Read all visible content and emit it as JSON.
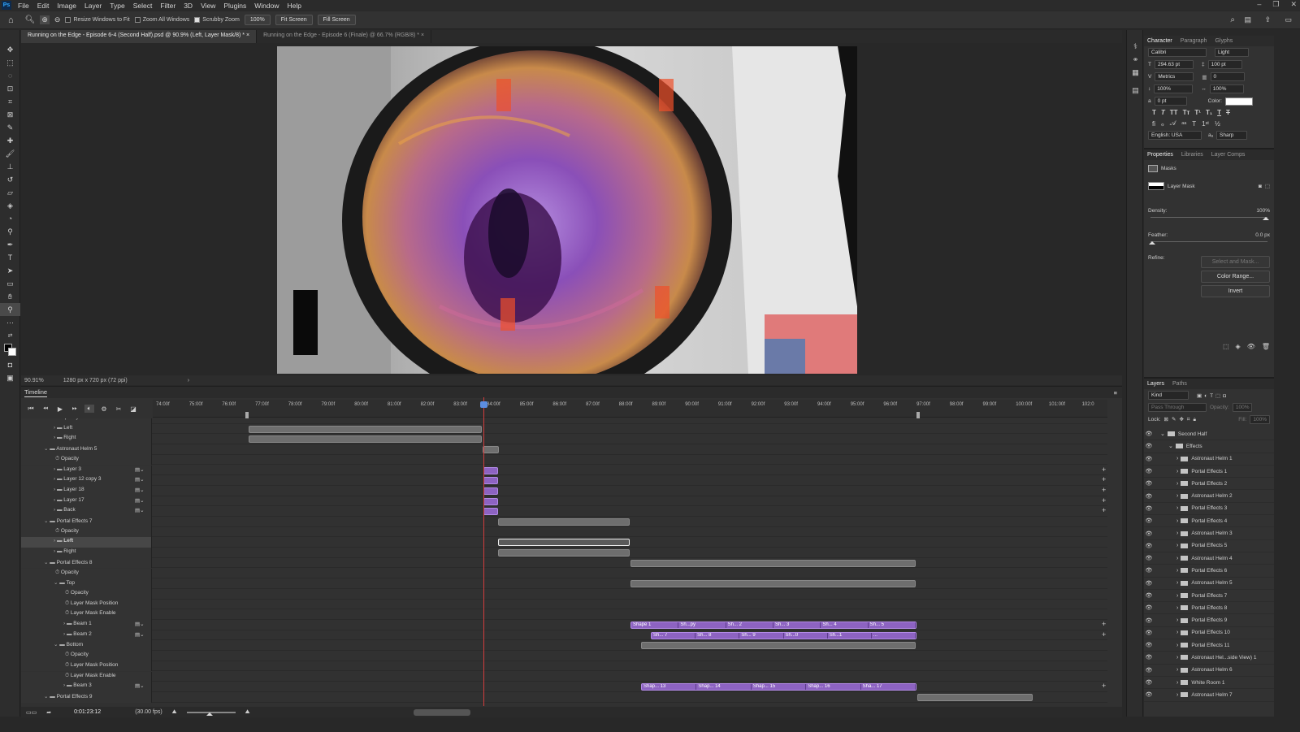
{
  "menu": {
    "app_icon": "Ps",
    "items": [
      "File",
      "Edit",
      "Image",
      "Layer",
      "Type",
      "Select",
      "Filter",
      "3D",
      "View",
      "Plugins",
      "Window",
      "Help"
    ]
  },
  "options": {
    "resize_windows": "Resize Windows to Fit",
    "zoom_all": "Zoom All Windows",
    "scrubby": "Scrubby Zoom",
    "zoom_value": "100%",
    "fit_screen": "Fit Screen",
    "fill_screen": "Fill Screen"
  },
  "tabs": [
    {
      "label": "Running on the Edge - Episode 6-4 (Second Half).psd @ 90.9% (Left, Layer Mask/8) *"
    },
    {
      "label": "Running on the Edge - Episode 6 (Finale) @ 66.7% (RGB/8) *"
    }
  ],
  "status": {
    "zoom": "90.91%",
    "doc_info": "1280 px x 720 px (72 ppi)"
  },
  "timeline": {
    "title": "Timeline",
    "ruler_labels": [
      "74:00f",
      "75:00f",
      "76:00f",
      "77:00f",
      "78:00f",
      "79:00f",
      "80:00f",
      "81:00f",
      "82:00f",
      "83:00f",
      "84:00f",
      "85:00f",
      "86:00f",
      "87:00f",
      "88:00f",
      "89:00f",
      "90:00f",
      "91:00f",
      "92:00f",
      "93:00f",
      "94:00f",
      "95:00f",
      "96:00f",
      "97:00f",
      "98:00f",
      "99:00f",
      "100:00f",
      "101:00f",
      "102:0"
    ],
    "timecode": "0:01:23:12",
    "fps": "(30.00 fps)",
    "rows": [
      {
        "label": "Opacity"
      },
      {
        "label": "Left"
      },
      {
        "label": "Right"
      },
      {
        "label": "Astronaut Helm 5"
      },
      {
        "label": "Opacity"
      },
      {
        "label": "Layer 3"
      },
      {
        "label": "Layer 12 copy 3"
      },
      {
        "label": "Layer 18"
      },
      {
        "label": "Layer 17"
      },
      {
        "label": "Back"
      },
      {
        "label": "Portal Effects 7"
      },
      {
        "label": "Opacity"
      },
      {
        "label": "Left"
      },
      {
        "label": "Right"
      },
      {
        "label": "Portal Effects 8"
      },
      {
        "label": "Opacity"
      },
      {
        "label": "Top"
      },
      {
        "label": "Opacity"
      },
      {
        "label": "Layer Mask Position"
      },
      {
        "label": "Layer Mask Enable"
      },
      {
        "label": "Beam 1"
      },
      {
        "label": "Beam 2"
      },
      {
        "label": "Bottom"
      },
      {
        "label": "Opacity"
      },
      {
        "label": "Layer Mask Position"
      },
      {
        "label": "Layer Mask Enable"
      },
      {
        "label": "Beam 3"
      },
      {
        "label": "Portal Effects 9"
      }
    ],
    "beam1_segments": [
      "Shape 1",
      "Sh...py",
      "Sh... 2",
      "Sh... 3",
      "Sh... 4",
      "Sh... 5"
    ],
    "beam2_segments": [
      "Sh... 7",
      "Sh... 8",
      "Sh... 9",
      "Sh...0",
      "Sh...1",
      "..."
    ],
    "beam3_segments": [
      "Shap... 13",
      "Shap... 14",
      "Shap... 15",
      "Shap... 16",
      "Sha... 17"
    ]
  },
  "character": {
    "tabs": [
      "Character",
      "Paragraph",
      "Glyphs"
    ],
    "font": "Calibri",
    "style": "Light",
    "size": "294.63 pt",
    "leading": "100 pt",
    "kerning": "Metrics",
    "tracking": "0",
    "vscale": "100%",
    "hscale": "100%",
    "baseline": "0 pt",
    "color_label": "Color:",
    "language": "English: USA",
    "aa": "Sharp"
  },
  "properties": {
    "tabs": [
      "Properties",
      "Libraries",
      "Layer Comps"
    ],
    "section": "Masks",
    "mask_type": "Layer Mask",
    "density_label": "Density:",
    "density": "100%",
    "feather_label": "Feather:",
    "feather": "0.0 px",
    "refine_label": "Refine:",
    "select_mask": "Select and Mask...",
    "color_range": "Color Range...",
    "invert": "Invert"
  },
  "layers": {
    "tabs": [
      "Layers",
      "Paths"
    ],
    "filter": "Kind",
    "blend": "Pass Through",
    "opacity_label": "Opacity:",
    "opacity": "100%",
    "lock_label": "Lock:",
    "fill_label": "Fill:",
    "fill": "100%",
    "items": [
      {
        "name": "Second Half",
        "indent": 0
      },
      {
        "name": "Effects",
        "indent": 1
      },
      {
        "name": "Astronaut Helm 1",
        "indent": 2
      },
      {
        "name": "Portal Effects 1",
        "indent": 2
      },
      {
        "name": "Portal Effects 2",
        "indent": 2
      },
      {
        "name": "Astronaut Helm 2",
        "indent": 2
      },
      {
        "name": "Portal Effects 3",
        "indent": 2
      },
      {
        "name": "Portal Effects 4",
        "indent": 2
      },
      {
        "name": "Astronaut Helm 3",
        "indent": 2
      },
      {
        "name": "Portal Effects 5",
        "indent": 2
      },
      {
        "name": "Astronaut Helm 4",
        "indent": 2
      },
      {
        "name": "Portal Effects 6",
        "indent": 2
      },
      {
        "name": "Astronaut Helm 5",
        "indent": 2
      },
      {
        "name": "Portal Effects 7",
        "indent": 2
      },
      {
        "name": "Portal Effects 8",
        "indent": 2
      },
      {
        "name": "Portal Effects 9",
        "indent": 2
      },
      {
        "name": "Portal Effects 10",
        "indent": 2
      },
      {
        "name": "Portal Effects 11",
        "indent": 2
      },
      {
        "name": "Astronaut Hel...side View) 1",
        "indent": 2
      },
      {
        "name": "Astronaut Helm 6",
        "indent": 2
      },
      {
        "name": "White Room 1",
        "indent": 2
      },
      {
        "name": "Astronaut Helm 7",
        "indent": 2
      }
    ]
  },
  "colors": {
    "accent": "#31a8ff",
    "clip_purple": "#8d63c2",
    "playhead": "#d23d3d"
  }
}
